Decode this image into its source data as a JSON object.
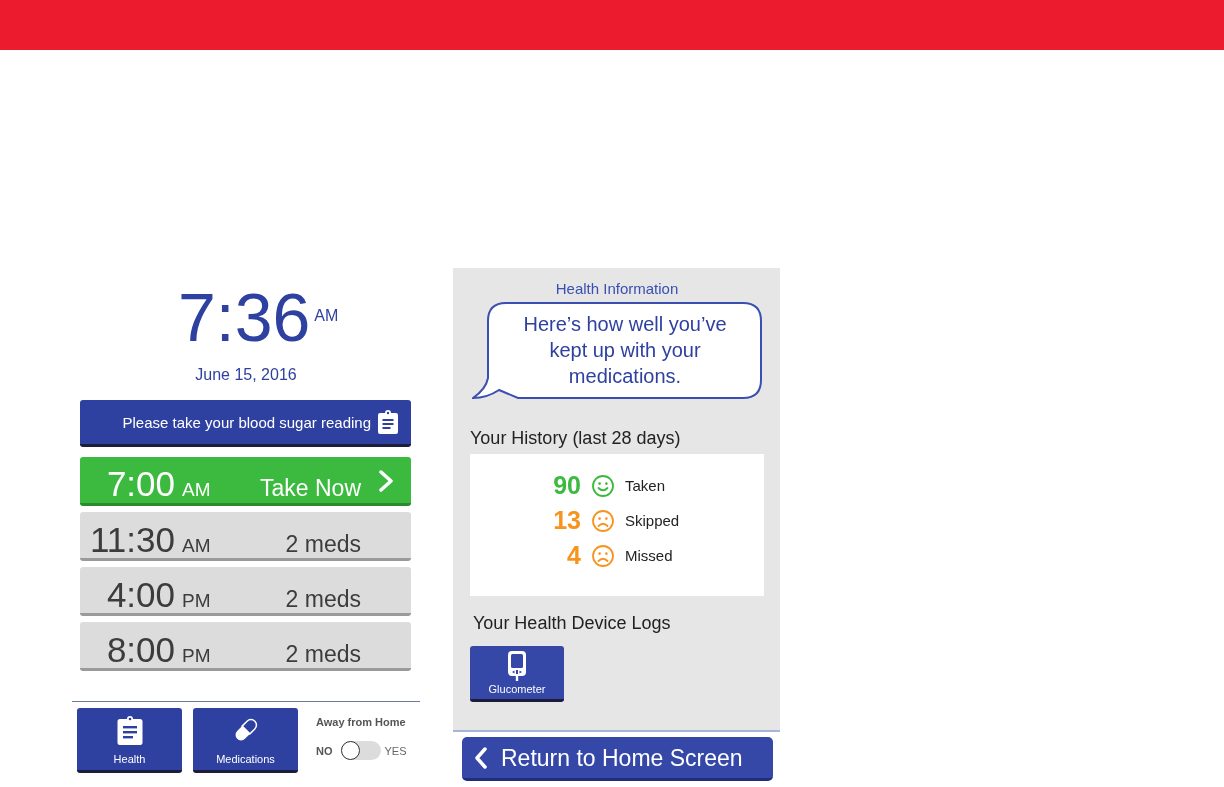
{
  "home_screen": {
    "clock": {
      "time": "7:36",
      "period": "AM"
    },
    "date": "June 15, 2016",
    "reminder": "Please take your blood sugar reading",
    "schedule": [
      {
        "time": "7:00",
        "period": "AM",
        "status": "Take Now",
        "due": true
      },
      {
        "time": "11:30",
        "period": "AM",
        "status": "2 meds",
        "due": false
      },
      {
        "time": "4:00",
        "period": "PM",
        "status": "2 meds",
        "due": false
      },
      {
        "time": "8:00",
        "period": "PM",
        "status": "2 meds",
        "due": false
      }
    ],
    "health_button": "Health",
    "medications_button": "Medications",
    "away_from_home": {
      "label": "Away from Home",
      "off_label": "NO",
      "on_label": "YES",
      "on": false
    }
  },
  "health_screen": {
    "title": "Health Information",
    "message": "Here’s how well you’ve kept up with your medications.",
    "history": {
      "title": "Your History (last 28 days)",
      "items": [
        {
          "count": "90",
          "label": "Taken",
          "kind": "happy",
          "color": "#3cb93f"
        },
        {
          "count": "13",
          "label": "Skipped",
          "kind": "sad",
          "color": "#f7941d"
        },
        {
          "count": "4",
          "label": "Missed",
          "kind": "sad",
          "color": "#f7941d"
        }
      ]
    },
    "device_logs": {
      "title": "Your Health Device Logs",
      "devices": [
        {
          "label": "Glucometer"
        }
      ]
    },
    "return_button": "Return to Home Screen"
  }
}
